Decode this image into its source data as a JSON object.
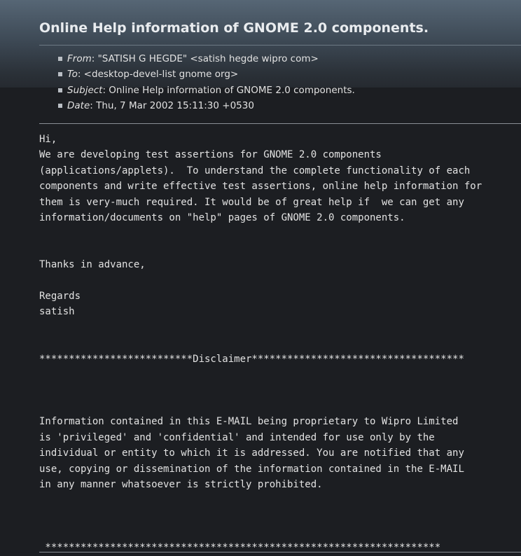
{
  "message": {
    "title": "Online Help information of GNOME 2.0 components.",
    "headers": [
      {
        "name": "From",
        "value": ": \"SATISH G HEGDE\" <satish hegde wipro com>"
      },
      {
        "name": "To",
        "value": ": <desktop-devel-list gnome org>"
      },
      {
        "name": "Subject",
        "value": ": Online Help information of GNOME 2.0 components."
      },
      {
        "name": "Date",
        "value": ": Thu, 7 Mar 2002 15:11:30 +0530"
      }
    ],
    "body": "Hi,\nWe are developing test assertions for GNOME 2.0 components\n(applications/applets).  To understand the complete functionality of each\ncomponents and write effective test assertions, online help information for\nthem is very-much required. It would be of great help if  we can get any\ninformation/documents on \"help\" pages of GNOME 2.0 components.\n\n\nThanks in advance,\n\nRegards\nsatish\n\n\n**************************Disclaimer************************************\n\n\n\nInformation contained in this E-MAIL being proprietary to Wipro Limited\nis 'privileged' and 'confidential' and intended for use only by the\nindividual or entity to which it is addressed. You are notified that any\nuse, copying or dissemination of the information contained in the E-MAIL\nin any manner whatsoever is strictly prohibited.\n\n\n\n *******************************************************************"
  },
  "colors": {
    "header_gradient_top": "#566675",
    "background": "#1c1e22",
    "text": "#e2e2e2"
  }
}
